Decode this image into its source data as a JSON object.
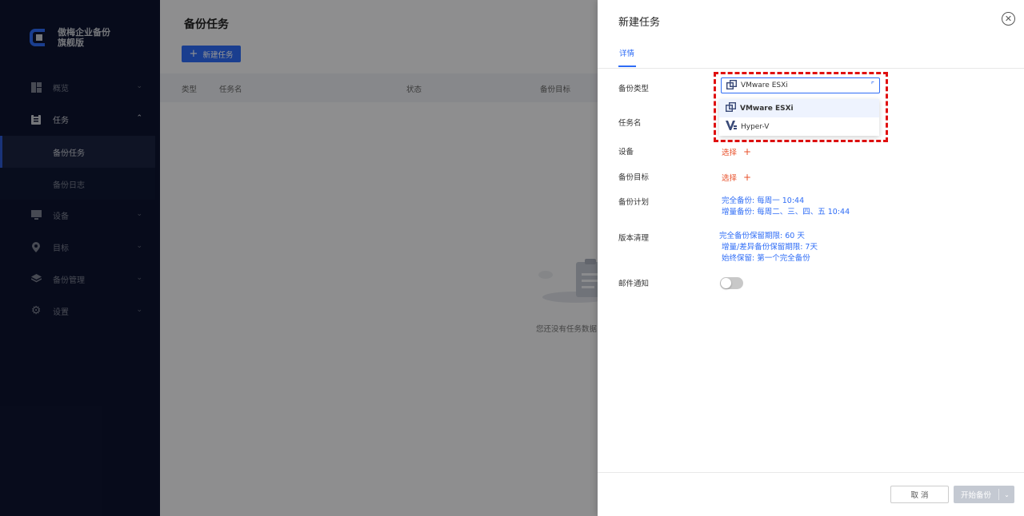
{
  "brand": {
    "name_line1": "傲梅企业备份",
    "name_line2": "旗舰版"
  },
  "sidebar": {
    "items": [
      {
        "label": "概览",
        "icon": "dashboard-icon"
      },
      {
        "label": "任务",
        "icon": "clipboard-icon"
      },
      {
        "label": "设备",
        "icon": "monitor-icon"
      },
      {
        "label": "目标",
        "icon": "location-pin-icon"
      },
      {
        "label": "备份管理",
        "icon": "layers-icon"
      },
      {
        "label": "设置",
        "icon": "gear-icon"
      }
    ],
    "subitems": [
      {
        "label": "备份任务"
      },
      {
        "label": "备份日志"
      }
    ]
  },
  "main": {
    "title": "备份任务",
    "new_task_button": "新建任务",
    "columns": [
      "类型",
      "任务名",
      "状态",
      "备份目标"
    ],
    "empty_text": "您还没有任务数据"
  },
  "drawer": {
    "title": "新建任务",
    "tab": "详情",
    "fields": {
      "backup_type_label": "备份类型",
      "task_name_label": "任务名",
      "device_label": "设备",
      "target_label": "备份目标",
      "plan_label": "备份计划",
      "cleanup_label": "版本清理",
      "email_label": "邮件通知"
    },
    "select_link": "选择",
    "selected_type": "VMware ESXi",
    "type_options": [
      {
        "label": "VMware ESXi",
        "icon": "vmware-icon"
      },
      {
        "label": "Hyper-V",
        "icon": "hyperv-icon"
      }
    ],
    "plan": {
      "full": "完全备份: 每周一 10:44",
      "incremental": "增量备份: 每周二、三、四、五 10:44"
    },
    "cleanup": {
      "full": "完全备份保留期限: 60 天",
      "incremental": "增量/差异备份保留期限: 7天",
      "always": "始终保留: 第一个完全备份"
    },
    "email_enabled": false,
    "cancel_button": "取 消",
    "start_button": "开始备份"
  },
  "colors": {
    "accent": "#2e6cf6",
    "sidebar_bg": "#0d1430",
    "link_orange": "#e8502a",
    "highlight_red": "#e01010"
  }
}
